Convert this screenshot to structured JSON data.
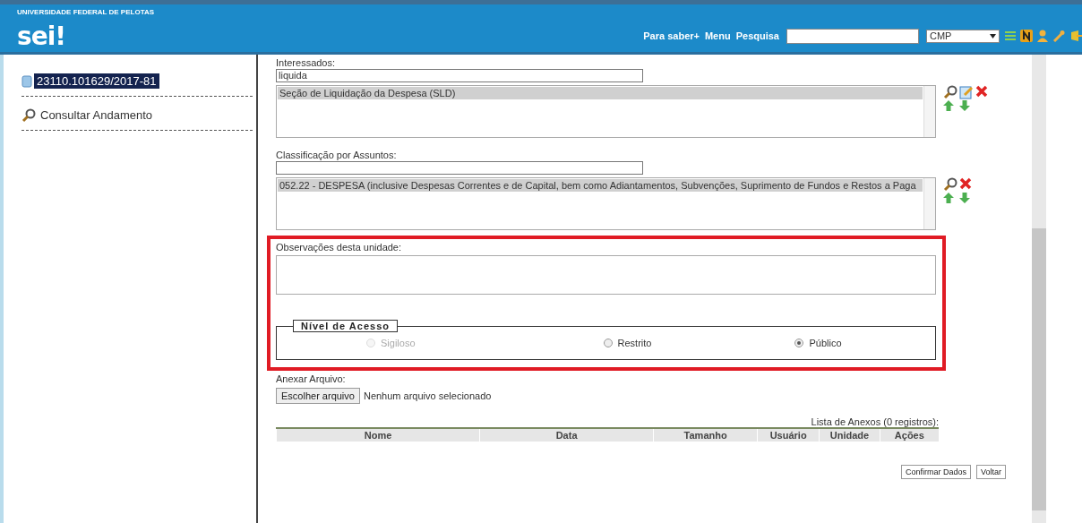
{
  "header": {
    "institution": "UNIVERSIDADE FEDERAL DE PELOTAS",
    "logo": "sei!",
    "links": [
      "Para saber+",
      "Menu"
    ],
    "search_label": "Pesquisa",
    "unit": "CMP"
  },
  "sidebar": {
    "process": {
      "label": "23110.101629/2017-81",
      "selected": true
    },
    "items": [
      {
        "label": "Consultar Andamento"
      }
    ]
  },
  "form": {
    "interessados": {
      "label": "Interessados:",
      "value": "liquida",
      "options": [
        {
          "label": "Seção de Liquidação da Despesa (SLD)",
          "selected": true
        }
      ]
    },
    "assuntos": {
      "label": "Classificação por Assuntos:",
      "options": [
        {
          "label": "052.22 - DESPESA (inclusive Despesas Correntes e de Capital, bem como Adiantamentos, Subvenções, Suprimento de Fundos e Restos a Paga",
          "selected": true
        }
      ]
    },
    "observacoes": {
      "label": "Observações desta unidade:"
    },
    "nivel_acesso": {
      "legend": "Nível de Acesso",
      "options": [
        {
          "label": "Sigiloso",
          "selected": false,
          "disabled": true
        },
        {
          "label": "Restrito",
          "selected": false,
          "disabled": false
        },
        {
          "label": "Público",
          "selected": true,
          "disabled": false
        }
      ]
    },
    "anexar": {
      "label": "Anexar Arquivo:",
      "button": "Escolher arquivo",
      "status": "Nenhum arquivo selecionado"
    },
    "anexos": {
      "caption": "Lista de Anexos (0 registros):",
      "columns": [
        "Nome",
        "Data",
        "Tamanho",
        "Usuário",
        "Unidade",
        "Ações"
      ]
    },
    "buttons": [
      "Confirmar Dados",
      "Voltar"
    ]
  }
}
